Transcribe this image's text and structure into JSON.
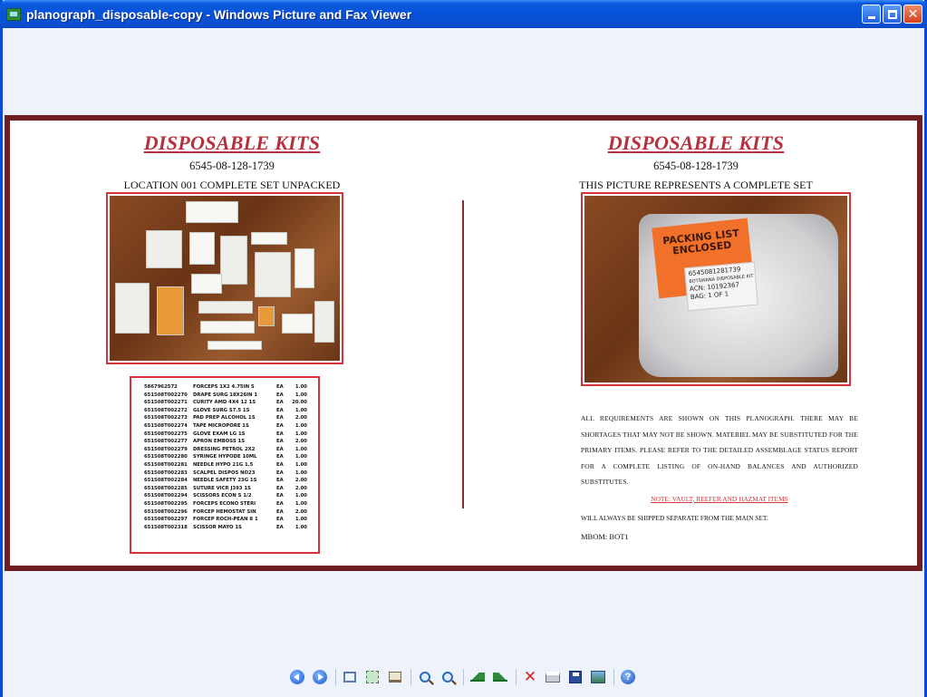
{
  "window": {
    "title": "planograph_disposable-copy - Windows Picture and Fax Viewer"
  },
  "left_panel": {
    "title": "DISPOSABLE KITS",
    "nsn": "6545-08-128-1739",
    "subtitle": "LOCATION 001 COMPLETE SET UNPACKED",
    "photo_label": "Disposable Kit 6545-08-128-1739",
    "items": [
      {
        "nsn": "5867962572",
        "desc": "FORCEPS 1X2 4.75IN S",
        "ui": "EA",
        "qty": "1.00"
      },
      {
        "nsn": "651508T002270",
        "desc": "DRAPE SURG 18X26IN 1",
        "ui": "EA",
        "qty": "1.00"
      },
      {
        "nsn": "651508T002271",
        "desc": "CURITY AMD 4X4 12 1S",
        "ui": "EA",
        "qty": "20.00"
      },
      {
        "nsn": "651508T002272",
        "desc": "GLOVE SURG S7.5 1S",
        "ui": "EA",
        "qty": "1.00"
      },
      {
        "nsn": "651508T002273",
        "desc": "PAD PREP ALCOHOL 1S",
        "ui": "EA",
        "qty": "2.00"
      },
      {
        "nsn": "651508T002274",
        "desc": "TAPE MICROPORE 1S",
        "ui": "EA",
        "qty": "1.00"
      },
      {
        "nsn": "651508T002275",
        "desc": "GLOVE EXAM LG 1S",
        "ui": "EA",
        "qty": "1.00"
      },
      {
        "nsn": "651508T002277",
        "desc": "APRON EMBOSS 1S",
        "ui": "EA",
        "qty": "2.00"
      },
      {
        "nsn": "651508T002279",
        "desc": "DRESSING PETROL 2X2",
        "ui": "EA",
        "qty": "1.00"
      },
      {
        "nsn": "651508T002280",
        "desc": "SYRINGE HYPODE 10ML",
        "ui": "EA",
        "qty": "1.00"
      },
      {
        "nsn": "651508T002281",
        "desc": "NEEDLE HYPO 21G 1.5",
        "ui": "EA",
        "qty": "1.00"
      },
      {
        "nsn": "651508T002283",
        "desc": "SCALPEL DISPOS NO23",
        "ui": "EA",
        "qty": "1.00"
      },
      {
        "nsn": "651508T002284",
        "desc": "NEEDLE SAFETY 23G 1S",
        "ui": "EA",
        "qty": "2.00"
      },
      {
        "nsn": "651508T002285",
        "desc": "SUTURE VICR J393 1S",
        "ui": "EA",
        "qty": "2.00"
      },
      {
        "nsn": "651508T002294",
        "desc": "SCISSORS ECON S 1/2",
        "ui": "EA",
        "qty": "1.00"
      },
      {
        "nsn": "651508T002295",
        "desc": "FORCEPS ECONO STERI",
        "ui": "EA",
        "qty": "1.00"
      },
      {
        "nsn": "651508T002296",
        "desc": "FORCEP HEMOSTAT SIN",
        "ui": "EA",
        "qty": "2.00"
      },
      {
        "nsn": "651508T002297",
        "desc": "FORCEP ROCH-PEAN 8 1",
        "ui": "EA",
        "qty": "1.00"
      },
      {
        "nsn": "651508T002318",
        "desc": "SCISSOR MAYO 1S",
        "ui": "EA",
        "qty": "1.00"
      }
    ]
  },
  "right_panel": {
    "title": "DISPOSABLE KITS",
    "nsn": "6545-08-128-1739",
    "subtitle": "THIS PICTURE REPRESENTS A COMPLETE SET",
    "packing_text": "PACKING LIST ENCLOSED",
    "tag_lines": [
      "6545081281739",
      "BOTSWANA DISPOSABLE KIT",
      "ACN: 10192367",
      "BAG: 1  OF 1"
    ],
    "paragraph": "ALL REQUIREMENTS ARE SHOWN ON THIS PLANOGRAPH. THERE MAY BE SHORTAGES THAT MAY NOT BE SHOWN. MATERIEL MAY BE SUBSTITUTED FOR THE PRIMARY ITEMS. PLEASE REFER TO THE DETAILED ASSEMBLAGE STATUS REPORT FOR A COMPLETE LISTING OF ON-HAND BALANCES AND AUTHORIZED SUBSTITUTES.",
    "note": "NOTE: VAULT, REEFER AND HAZMAT ITEMS",
    "note_line": "WILL ALWAYS BE SHIPPED SEPARATE FROM THE MAIN SET.",
    "mbom": "MBOM:  BOT1"
  },
  "colors": {
    "title_red": "#b5313d",
    "frame": "#6f1f22",
    "titlebar": "#0852d8"
  },
  "toolbar": {
    "icons": [
      "previous-image-icon",
      "next-image-icon",
      "best-fit-icon",
      "actual-size-icon",
      "slide-show-icon",
      "zoom-in-icon",
      "zoom-out-icon",
      "rotate-clockwise-icon",
      "rotate-counterclockwise-icon",
      "delete-icon",
      "print-icon",
      "save-icon",
      "edit-icon",
      "help-icon"
    ]
  }
}
